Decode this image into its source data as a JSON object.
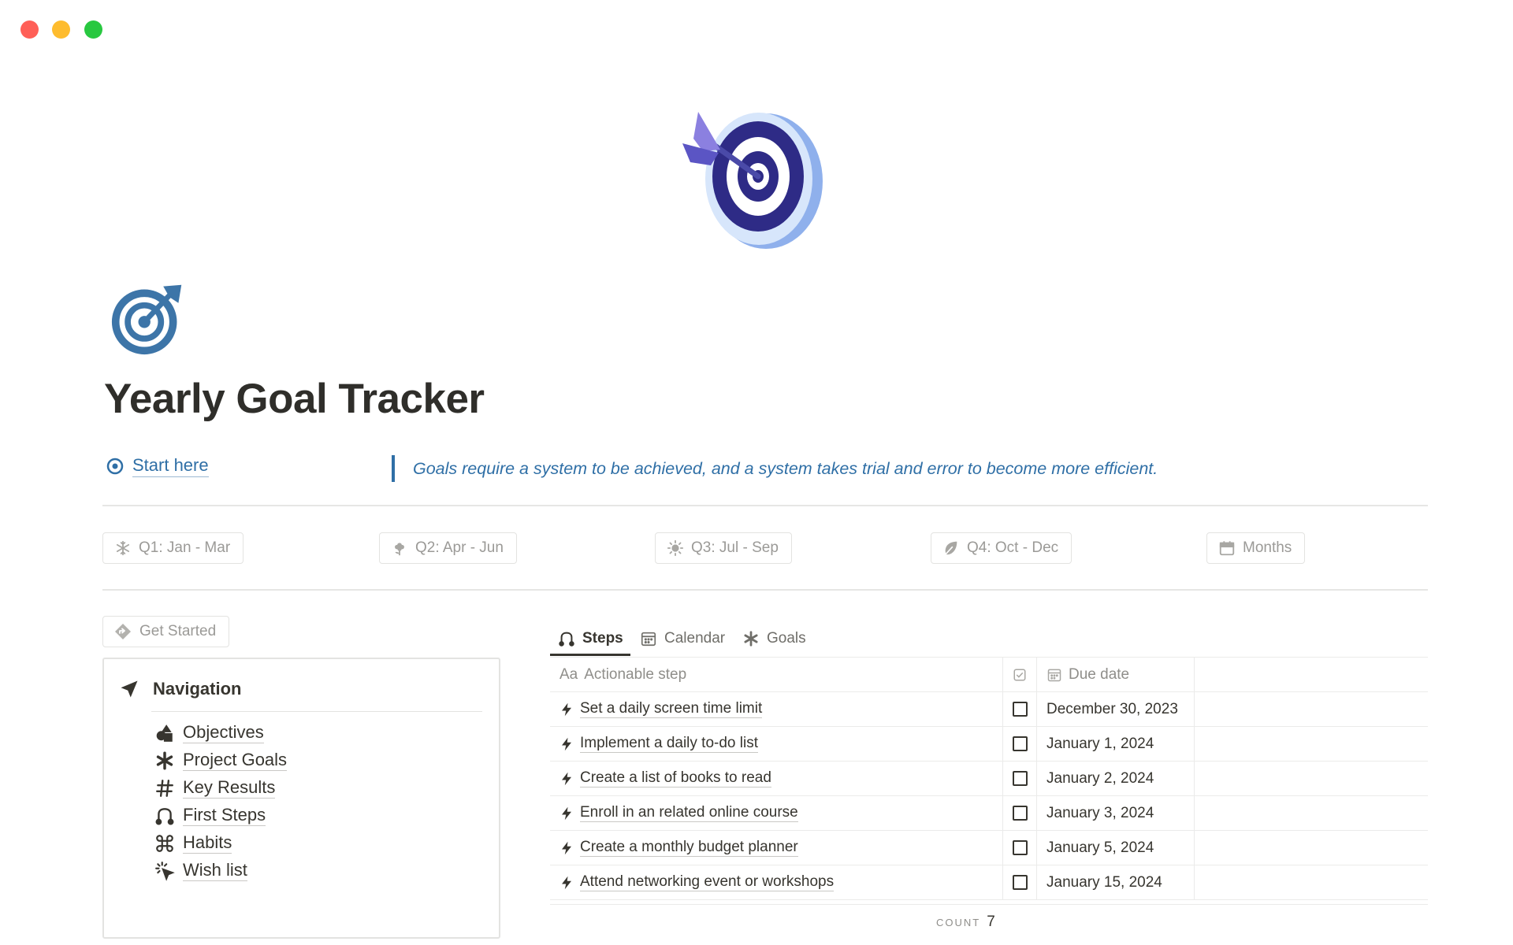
{
  "page": {
    "title": "Yearly Goal Tracker",
    "start_link": "Start here",
    "quote": "Goals require a system to be achieved, and a system takes trial and error to become more efficient."
  },
  "quarters": [
    {
      "label": "Q1: Jan - Mar",
      "icon": "snowflake-icon"
    },
    {
      "label": "Q2: Apr - Jun",
      "icon": "flower-icon"
    },
    {
      "label": "Q3: Jul - Sep",
      "icon": "sun-icon"
    },
    {
      "label": "Q4: Oct - Dec",
      "icon": "leaf-icon"
    },
    {
      "label": "Months",
      "icon": "calendar-icon"
    }
  ],
  "get_started": {
    "label": "Get Started",
    "icon": "diamond-arrow-icon"
  },
  "navigation": {
    "title": "Navigation",
    "items": [
      {
        "label": "Objectives",
        "icon": "shapes-icon"
      },
      {
        "label": "Project Goals",
        "icon": "asterisk-icon"
      },
      {
        "label": "Key Results",
        "icon": "hashtag-icon"
      },
      {
        "label": "First Steps",
        "icon": "route-icon"
      },
      {
        "label": "Habits",
        "icon": "command-icon"
      },
      {
        "label": "Wish list",
        "icon": "sparkle-cursor-icon"
      }
    ]
  },
  "tabs": [
    {
      "label": "Steps",
      "icon": "route-icon",
      "active": true
    },
    {
      "label": "Calendar",
      "icon": "calendar-icon",
      "active": false
    },
    {
      "label": "Goals",
      "icon": "asterisk-icon",
      "active": false
    }
  ],
  "table": {
    "columns": {
      "step_prefix": "Aa",
      "step": "Actionable step",
      "done_icon": "checkbox-icon",
      "due": "Due date"
    },
    "rows": [
      {
        "step": "Set a daily screen time limit",
        "done": false,
        "due": "December 30, 2023"
      },
      {
        "step": "Implement a daily to-do list",
        "done": false,
        "due": "January 1, 2024"
      },
      {
        "step": "Create a list of books to read",
        "done": false,
        "due": "January 2, 2024"
      },
      {
        "step": "Enroll in an related online course",
        "done": false,
        "due": "January 3, 2024"
      },
      {
        "step": "Create a monthly budget planner",
        "done": false,
        "due": "January 5, 2024"
      },
      {
        "step": "Attend networking event or workshops",
        "done": false,
        "due": "January 15, 2024"
      }
    ],
    "count_label": "COUNT",
    "count_value": "7"
  },
  "colors": {
    "accent": "#2f6fa6",
    "text": "#37352f",
    "muted": "#9b9a97"
  }
}
